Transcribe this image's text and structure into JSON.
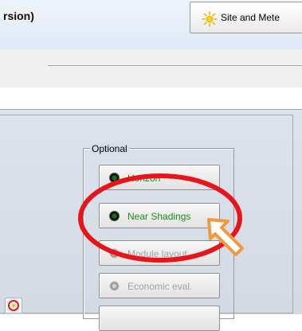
{
  "toolbar": {
    "site_button_label": "Site and Mete"
  },
  "section": {
    "title": "rsion)"
  },
  "optional_group": {
    "label": "Optional",
    "buttons": [
      {
        "label": "Horizon",
        "state": "active"
      },
      {
        "label": "Near Shadings",
        "state": "active"
      },
      {
        "label": "Module layout",
        "state": "disabled"
      },
      {
        "label": "Economic eval.",
        "state": "disabled"
      }
    ]
  },
  "colors": {
    "active_text": "#1c8a1c",
    "disabled_text": "#a3a3a3",
    "highlight_ellipse": "#e8141b",
    "pointer_arrow": "#f29a3a"
  }
}
